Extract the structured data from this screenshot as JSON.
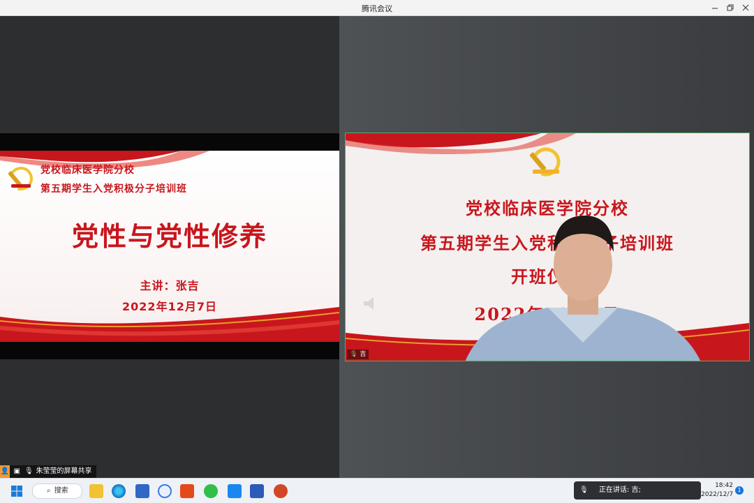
{
  "window": {
    "title": "腾讯会议"
  },
  "shared_slide": {
    "school": "党校临床医学院分校",
    "class_name": "第五期学生入党积极分子培训班",
    "topic": "党性与党性修养",
    "presenter": "主讲：张吉",
    "date": "2022年12月7日"
  },
  "camera": {
    "line1": "党校临床医学院分校",
    "line2": "第五期学生入党积极分子培训班",
    "line3": "开班仪式",
    "line4": "2022年12月7日",
    "name_tag": "吉"
  },
  "share_info": {
    "text": "朱莹莹的屏幕共享"
  },
  "taskbar": {
    "search_label": "搜索",
    "speaking_text": "正在讲话: 吉;",
    "time": "18:42",
    "date": "2022/12/7",
    "notifications": "1"
  },
  "colors": {
    "party_red": "#c8161d",
    "speaker_border": "#4fae6a",
    "gold": "#f2c230"
  }
}
